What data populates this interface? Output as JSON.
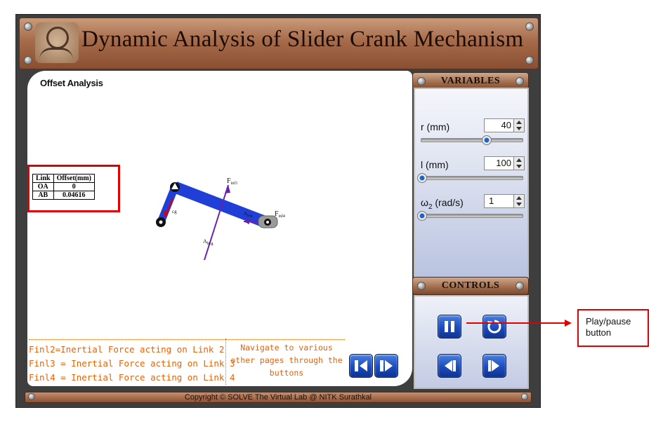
{
  "header": {
    "title": "Dynamic Analysis of Slider Crank Mechanism"
  },
  "canvas": {
    "title": "Offset Analysis",
    "offset_table": {
      "headers": [
        "Link",
        "Offset(mm)"
      ],
      "rows": [
        [
          "OA",
          "0"
        ],
        [
          "AB",
          "0.04616"
        ]
      ]
    },
    "force_labels": {
      "finl3": "F",
      "finl3_sub": "inl3",
      "finl4": "F",
      "finl4_sub": "inl4",
      "acg_lower": "A",
      "acg_lower_sub": "bcg",
      "acg_upper": "A",
      "acg_upper_sub": "bcg",
      "a2cg": "cg"
    },
    "legend": [
      "Finl2=Inertial Force acting on Link 2",
      "Finl3 = Inertial Force acting on Link 3",
      "Finl4 = Inertial Force acting on Link 4"
    ],
    "nav_note": "Navigate to various other pages through the buttons"
  },
  "variables": {
    "header": "VARIABLES",
    "items": [
      {
        "label": "r (mm)",
        "value": "40",
        "slider_fraction": 0.64
      },
      {
        "label": "l (mm)",
        "value": "100",
        "slider_fraction": 0.0
      },
      {
        "label": "ω",
        "sub": "2",
        "unit": " (rad/s)",
        "value": "1",
        "slider_fraction": 0.0
      }
    ]
  },
  "controls": {
    "header": "CONTROLS"
  },
  "footer": {
    "copyright": "Copyright © SOLVE The Virtual Lab @ NITK Surathkal"
  },
  "annotation": {
    "text_line1": "Play/pause",
    "text_line2": "button"
  },
  "colors": {
    "accent_orange": "#e8620a",
    "link_blue": "#1f3fd6",
    "force_purple": "#6a1fb0",
    "highlight_red": "#e00000",
    "button_blue": "#1b4bbd"
  },
  "icons": {
    "play_pause": "pause-icon",
    "reset": "reset-icon",
    "prev": "step-back-icon",
    "next": "step-forward-icon"
  }
}
